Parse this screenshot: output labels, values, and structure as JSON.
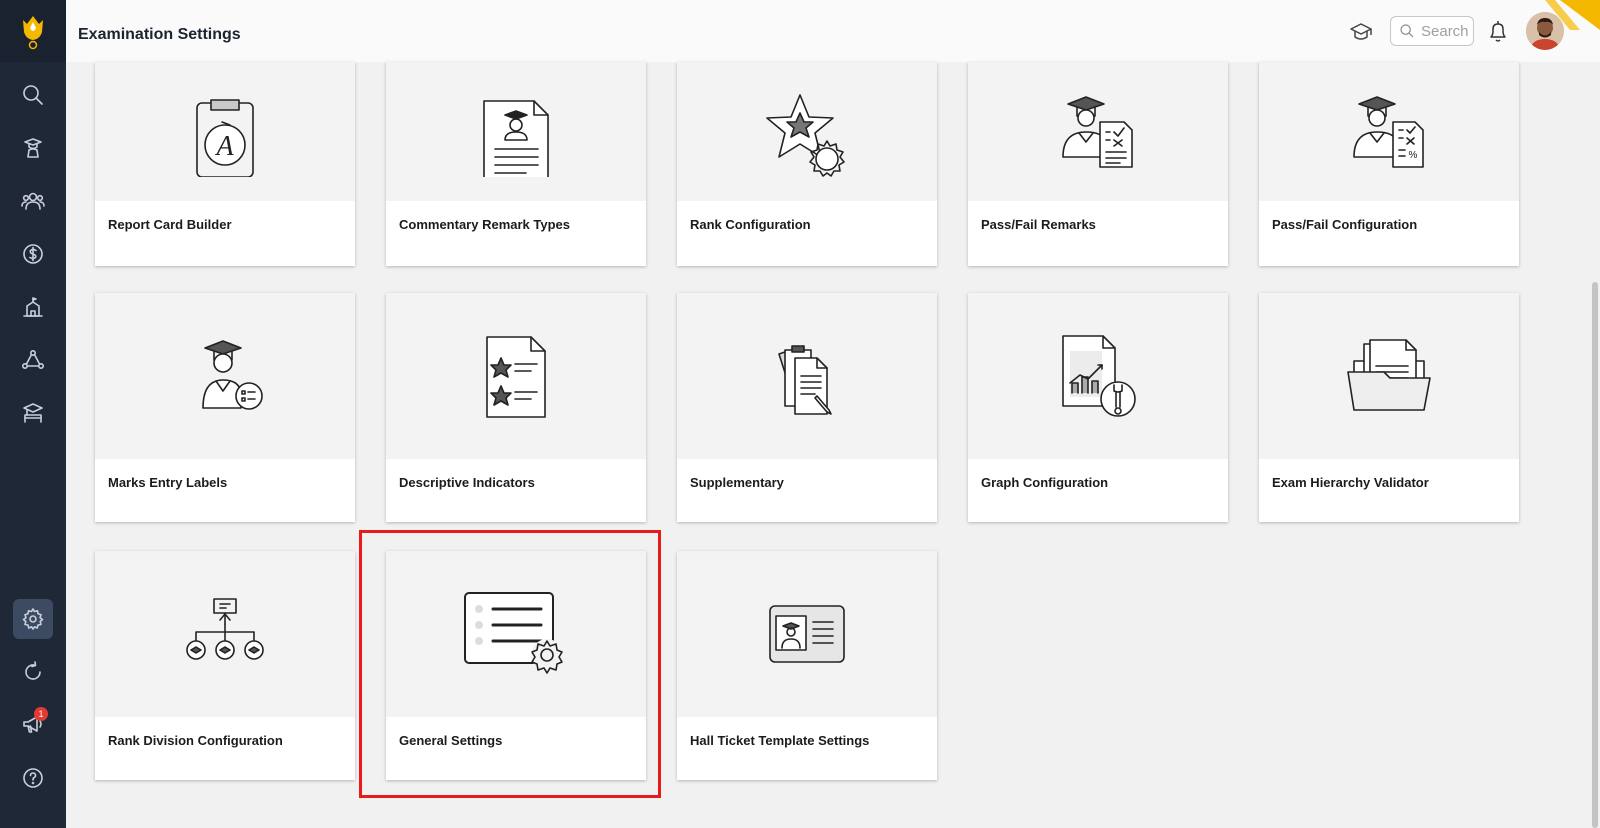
{
  "header": {
    "title": "Examination Settings",
    "search_placeholder": "Search"
  },
  "sidebar": {
    "items": [
      {
        "icon": "search-icon"
      },
      {
        "icon": "student-icon"
      },
      {
        "icon": "users-icon"
      },
      {
        "icon": "dollar-icon"
      },
      {
        "icon": "school-icon"
      },
      {
        "icon": "network-icon"
      },
      {
        "icon": "exam-icon"
      },
      {
        "icon": "gear-icon",
        "active": true
      },
      {
        "icon": "refresh-icon"
      },
      {
        "icon": "megaphone-icon",
        "badge": "1"
      },
      {
        "icon": "help-icon"
      }
    ]
  },
  "cards": [
    {
      "label": "Report Card Builder",
      "icon": "report-card-icon"
    },
    {
      "label": "Commentary Remark Types",
      "icon": "remark-document-icon"
    },
    {
      "label": "Rank Configuration",
      "icon": "star-gear-icon"
    },
    {
      "label": "Pass/Fail Remarks",
      "icon": "graduate-checklist-icon"
    },
    {
      "label": "Pass/Fail Configuration",
      "icon": "graduate-percent-icon"
    },
    {
      "label": "Marks Entry Labels",
      "icon": "graduate-form-icon"
    },
    {
      "label": "Descriptive Indicators",
      "icon": "star-document-icon"
    },
    {
      "label": "Supplementary",
      "icon": "clipboard-pen-icon"
    },
    {
      "label": "Graph Configuration",
      "icon": "chart-wrench-icon"
    },
    {
      "label": "Exam Hierarchy Validator",
      "icon": "folder-documents-icon"
    },
    {
      "label": "Rank Division Configuration",
      "icon": "hierarchy-icon"
    },
    {
      "label": "General Settings",
      "icon": "list-gear-icon"
    },
    {
      "label": "Hall Ticket Template Settings",
      "icon": "id-card-icon"
    }
  ],
  "colors": {
    "sidebar": "#1e2836",
    "highlight": "#e81a1a",
    "accent": "#f5b800"
  }
}
